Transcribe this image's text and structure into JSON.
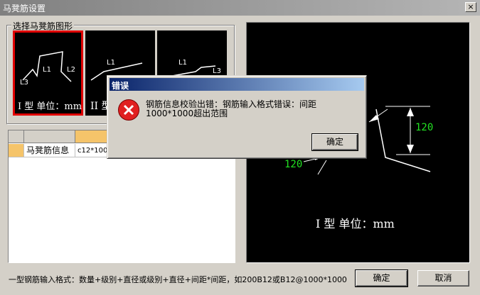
{
  "window": {
    "title": "马凳筋设置",
    "close_glyph": "×"
  },
  "shape_group": {
    "label": "选择马凳筋图形",
    "shapes": [
      {
        "label": "I 型  单位：mm",
        "selected": true
      },
      {
        "label": "II 型",
        "selected": false
      },
      {
        "label": "",
        "selected": false
      }
    ],
    "seg_labels": {
      "l1": "L1",
      "l2": "L2",
      "l3": "L3"
    }
  },
  "grid": {
    "rows": [
      {
        "name": "马凳筋信息",
        "value": "c12*1000"
      }
    ]
  },
  "preview": {
    "caption": "I 型  单位：mm",
    "dims": {
      "vertical": "120",
      "bottom": "120"
    }
  },
  "hint": "一型钢筋输入格式：数量+级别+直径或级别+直径+间距*间距，如200B12或B12@1000*1000",
  "buttons": {
    "ok": "确定",
    "cancel": "取消"
  },
  "error_dialog": {
    "title": "错误",
    "message": "钢筋信息校验出错：钢筋输入格式错误：间距1000*1000超出范围",
    "ok": "确定",
    "icon": "error-icon"
  },
  "colors": {
    "selected_border": "#e00000",
    "dimension_text": "#22e022",
    "grid_header_accent": "#f5c46a"
  }
}
